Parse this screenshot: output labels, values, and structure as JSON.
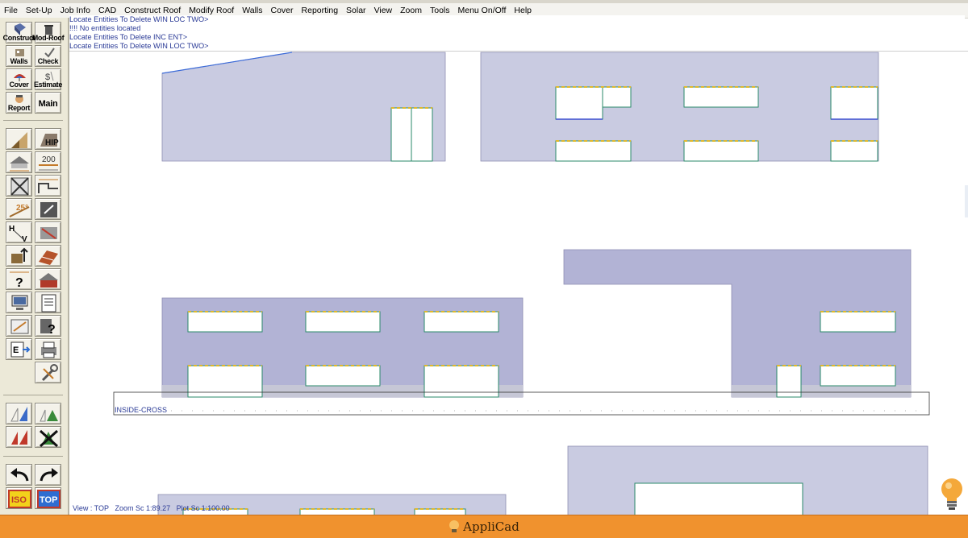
{
  "menu": [
    "File",
    "Set-Up",
    "Job Info",
    "CAD",
    "Construct Roof",
    "Modify Roof",
    "Walls",
    "Cover",
    "Reporting",
    "Solar",
    "View",
    "Zoom",
    "Tools",
    "Menu On/Off",
    "Help"
  ],
  "command_log": [
    "Locate Entities To Delete WIN LOC TWO>",
    "!!!! No entities located",
    "Locate Entities To Delete INC ENT>",
    "Locate Entities To Delete WIN LOC TWO>"
  ],
  "toolbar": {
    "construct": "Construct",
    "mod_roof": "Mod-Roof",
    "walls": "Walls",
    "check": "Check",
    "cover": "Cover",
    "estimate": "Estimate",
    "report": "Report",
    "main": "Main",
    "hip": "HIP",
    "dim_200": "200",
    "angle_25": "25°",
    "iso": "ISO",
    "top": "TOP"
  },
  "drawing": {
    "section_label": "INSIDE-CROSS"
  },
  "status": {
    "view": "View : TOP",
    "zoom": "Zoom Sc 1:89.27",
    "plot": "Plot Sc 1:100.00"
  },
  "brand": "AppliCad",
  "colors": {
    "wall_fill": "#c9cbe1",
    "wall_fill_dark": "#b2b3d5",
    "accent": "#f0922e",
    "log_text": "#2a3a96"
  }
}
